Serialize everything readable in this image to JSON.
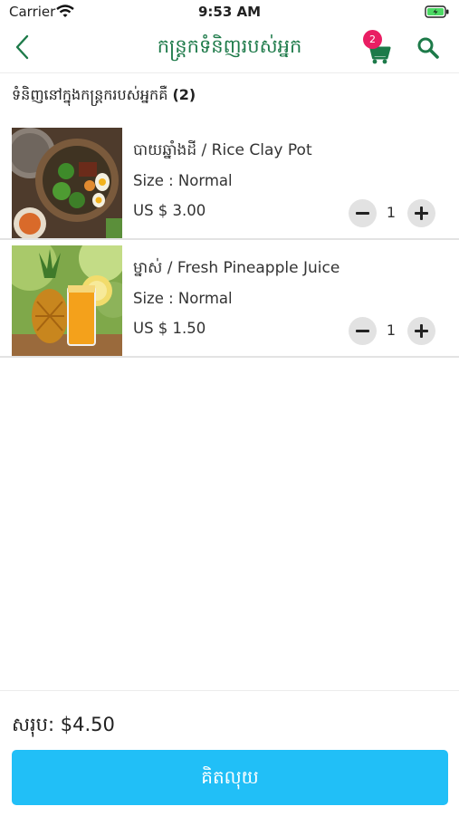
{
  "status_bar": {
    "carrier": "Carrier",
    "time": "9:53 AM"
  },
  "nav": {
    "title": "កន្ត្រកទំនិញរបស់អ្នក",
    "cart_count": "2"
  },
  "section": {
    "label": "ទំនិញនៅក្នុងកន្ត្រករបស់អ្នកគឺ",
    "count": "(2)"
  },
  "items": [
    {
      "name": "បាយឆ្នាំងដី / Rice Clay Pot",
      "size": "Size : Normal",
      "price": "US $ 3.00",
      "qty": "1"
    },
    {
      "name": "ម្នាស់ / Fresh Pineapple Juice",
      "size": "Size : Normal",
      "price": "US $ 1.50",
      "qty": "1"
    }
  ],
  "footer": {
    "total": "សរុប: $4.50",
    "pay_label": "គិតលុយ"
  },
  "colors": {
    "accent_green": "#1d7a49",
    "badge": "#e91e63",
    "pay_button": "#21bff7"
  }
}
